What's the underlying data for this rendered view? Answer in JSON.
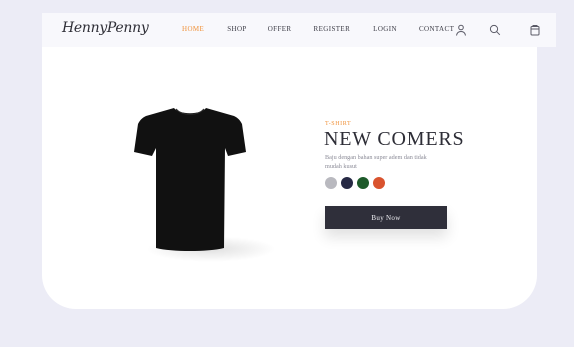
{
  "brand": {
    "logo_text": "HennyPenny"
  },
  "nav": {
    "links": [
      {
        "label": "HOME",
        "active": true
      },
      {
        "label": "SHOP",
        "active": false
      },
      {
        "label": "OFFER",
        "active": false
      },
      {
        "label": "REGISTER",
        "active": false
      },
      {
        "label": "LOGIN",
        "active": false
      },
      {
        "label": "CONTACT",
        "active": false
      }
    ],
    "icons": [
      "user-icon",
      "search-icon",
      "cart-icon"
    ],
    "active_color": "#f0923a"
  },
  "hero": {
    "category": "T-SHIRT",
    "headline": "NEW COMERS",
    "description": "Baju dengan bahan super adem dan tidak mudah kusut",
    "product_icon": "tshirt-icon",
    "product_color": "#111111",
    "swatches": [
      {
        "color": "#b9b9bf"
      },
      {
        "color": "#262944"
      },
      {
        "color": "#1d5a2a"
      },
      {
        "color": "#d9532e"
      }
    ],
    "button_label": "Buy Now"
  }
}
